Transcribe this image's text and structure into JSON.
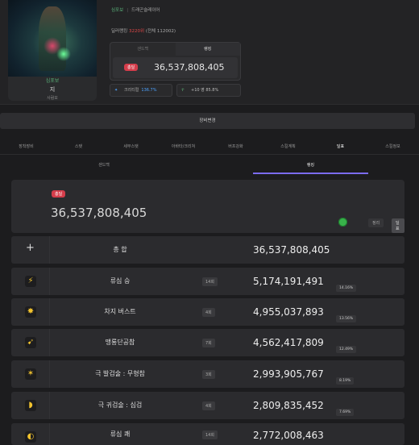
{
  "character": {
    "server": "심포보",
    "name": "지",
    "level": "사람모"
  },
  "breadcrumb": {
    "a": "심포보",
    "b": "드래곤슬레이어"
  },
  "rank": {
    "prefix": "딜러랭킹",
    "value": "3220위",
    "suffix": "(전체 112002)"
  },
  "dmg_box": {
    "tab_left": "샌드백",
    "tab_right": "랭킹",
    "badge": "총딜",
    "value": "36,537,808,405"
  },
  "stats": [
    {
      "icon": "star-icon",
      "label": "크리티컬",
      "value": "136.7%"
    },
    {
      "icon": "figure-icon",
      "label": "+10 영 85.8%",
      "value": ""
    }
  ],
  "setbar_label": "장비변경",
  "tabs1": [
    "장착장비",
    "스탯",
    "세부스탯",
    "아바타/크리쳐",
    "버프강화",
    "스킬계획",
    "딜표",
    "스킬정보"
  ],
  "tabs1_active": 6,
  "tabs2": [
    "샌드백",
    "랭킹"
  ],
  "total_card": {
    "badge": "총딜",
    "value": "36,537,808,405",
    "btn1": "정리",
    "btn2": "딜표"
  },
  "rows": [
    {
      "icon": "plus-icon",
      "name": "총 합",
      "hits": "",
      "dmg": "36,537,808,405",
      "pct": ""
    },
    {
      "icon": "skill-icon",
      "name": "류심 승",
      "hits": "14회",
      "dmg": "5,174,191,491",
      "pct": "14.16%"
    },
    {
      "icon": "skill-icon",
      "name": "차지 버스트",
      "hits": "4회",
      "dmg": "4,955,037,893",
      "pct": "13.56%"
    },
    {
      "icon": "skill-icon",
      "name": "맹룡단공참",
      "hits": "7회",
      "dmg": "4,562,417,809",
      "pct": "12.49%"
    },
    {
      "icon": "skill-icon",
      "name": "극 발검술 : 무형참",
      "hits": "3회",
      "dmg": "2,993,905,767",
      "pct": "8.19%"
    },
    {
      "icon": "skill-icon",
      "name": "극 귀검술 : 심검",
      "hits": "4회",
      "dmg": "2,809,835,452",
      "pct": "7.69%"
    },
    {
      "icon": "skill-icon",
      "name": "류심 쾌",
      "hits": "14회",
      "dmg": "2,772,008,463",
      "pct": ""
    }
  ],
  "colors": {
    "accent": "#7b6cf0",
    "badge": "#d43d4b",
    "green": "#5ab37a",
    "blue": "#4da3ff"
  }
}
